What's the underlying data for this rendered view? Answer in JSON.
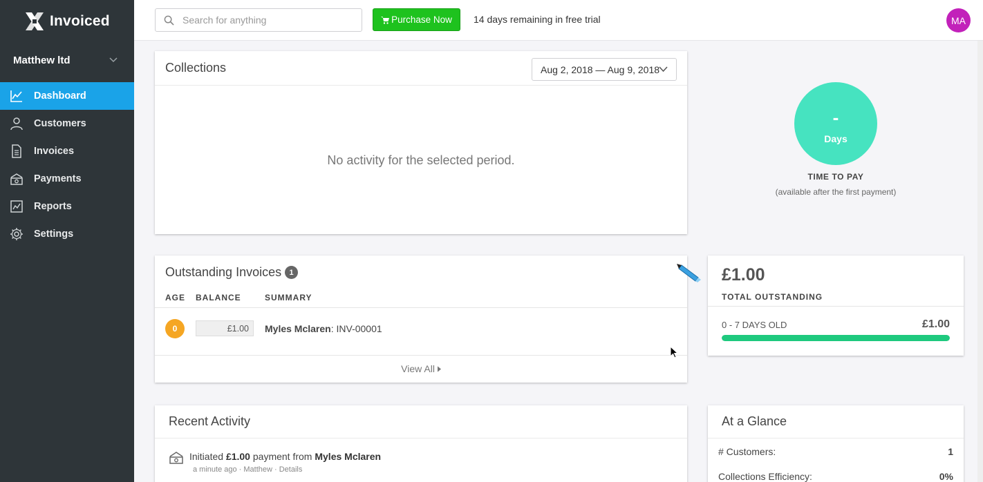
{
  "app": {
    "name": "Invoiced"
  },
  "company": {
    "name": "Matthew ltd"
  },
  "nav": {
    "items": [
      {
        "label": "Dashboard",
        "icon": "chart-line-icon",
        "active": true
      },
      {
        "label": "Customers",
        "icon": "user-icon",
        "active": false
      },
      {
        "label": "Invoices",
        "icon": "document-icon",
        "active": false
      },
      {
        "label": "Payments",
        "icon": "cash-icon",
        "active": false
      },
      {
        "label": "Reports",
        "icon": "report-icon",
        "active": false
      },
      {
        "label": "Settings",
        "icon": "gear-icon",
        "active": false
      }
    ]
  },
  "topbar": {
    "search_placeholder": "Search for anything",
    "purchase_label": "Purchase Now",
    "trial_text": "14 days remaining in free trial",
    "avatar_initials": "MA"
  },
  "collections": {
    "title": "Collections",
    "date_range": "Aug 2, 2018 — Aug 9, 2018",
    "empty_message": "No activity for the selected period."
  },
  "time_to_pay": {
    "value": "-",
    "unit": "Days",
    "label": "TIME TO PAY",
    "note": "(available after the first payment)"
  },
  "outstanding": {
    "title": "Outstanding Invoices",
    "count": "1",
    "columns": [
      "AGE",
      "BALANCE",
      "SUMMARY"
    ],
    "rows": [
      {
        "age": "0",
        "balance": "£1.00",
        "customer": "Myles Mclaren",
        "invoice": "INV-00001"
      }
    ],
    "view_all": "View All"
  },
  "total": {
    "amount": "£1.00",
    "label": "TOTAL OUTSTANDING",
    "aging_label": "0 - 7 DAYS OLD",
    "aging_amount": "£1.00",
    "aging_fraction": 1.0
  },
  "recent_activity": {
    "title": "Recent Activity",
    "items": [
      {
        "prefix": "Initiated",
        "amount": "£1.00",
        "middle": "payment from",
        "customer": "Myles Mclaren",
        "meta": "a minute ago · Matthew · Details"
      }
    ]
  },
  "glance": {
    "title": "At a Glance",
    "rows": [
      {
        "label": "# Customers:",
        "value": "1"
      },
      {
        "label": "Collections Efficiency:",
        "value": "0%"
      }
    ]
  },
  "colors": {
    "sidebar": "#2e3539",
    "active_nav": "#1aa3e8",
    "purchase": "#1ec21e",
    "avatar": "#c221ba",
    "ttp_circle": "#46e3c0",
    "age_badge": "#f5a623",
    "aging_bar": "#1ec97e"
  }
}
